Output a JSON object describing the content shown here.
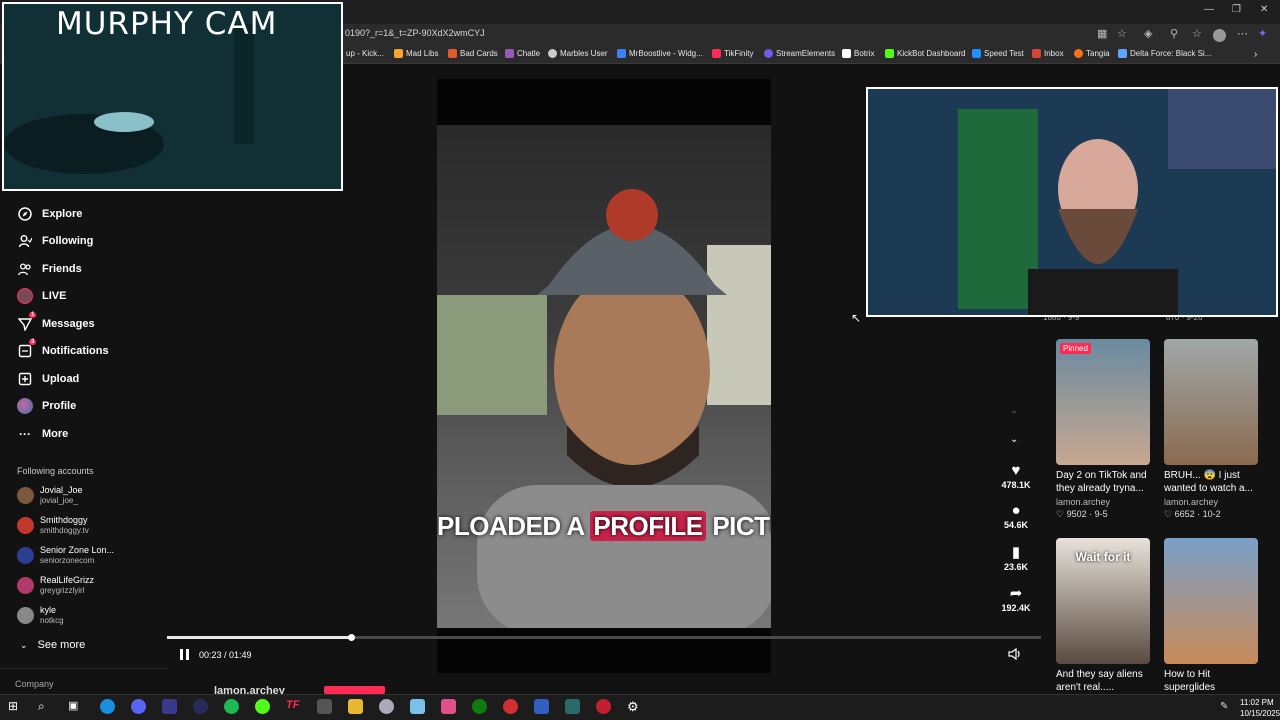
{
  "browser": {
    "url": "0190?_r=1&_t=ZP-90XdX2wmCYJ",
    "bookmarks": [
      {
        "label": "up - Kick...",
        "color": "#53fc18"
      },
      {
        "label": "Mad Libs",
        "color": "#f7a52b"
      },
      {
        "label": "Bad Cards",
        "color": "#e05a2b"
      },
      {
        "label": "Chatle",
        "color": "#9b59b6"
      },
      {
        "label": "Marbles User",
        "color": "#cccccc"
      },
      {
        "label": "MrBoostlive - Widg...",
        "color": "#3b82f6"
      },
      {
        "label": "TikFinity",
        "color": "#fe2c55"
      },
      {
        "label": "StreamElements",
        "color": "#6c5ce7"
      },
      {
        "label": "Botrix",
        "color": "#ffffff"
      },
      {
        "label": "KickBot Dashboard",
        "color": "#53fc18"
      },
      {
        "label": "Speed Test",
        "color": "#1e90ff"
      },
      {
        "label": "Inbox",
        "color": "#d44638"
      },
      {
        "label": "Tangia",
        "color": "#f97316"
      },
      {
        "label": "Delta Force: Black Si...",
        "color": "#60a5fa"
      }
    ]
  },
  "sidebar": {
    "items": [
      {
        "label": "Explore",
        "icon": "compass-icon"
      },
      {
        "label": "Following",
        "icon": "person-icon"
      },
      {
        "label": "Friends",
        "icon": "people-icon"
      },
      {
        "label": "LIVE",
        "icon": "live-icon"
      },
      {
        "label": "Messages",
        "icon": "send-icon",
        "badge": "1"
      },
      {
        "label": "Notifications",
        "icon": "inbox-icon",
        "badge": "3"
      },
      {
        "label": "Upload",
        "icon": "plus-square-icon"
      },
      {
        "label": "Profile",
        "icon": "avatar-icon"
      },
      {
        "label": "More",
        "icon": "more-icon"
      }
    ],
    "following_title": "Following accounts",
    "accounts": [
      {
        "name": "Jovial_Joe",
        "handle": "jovial_joe_",
        "color": "#7a5a3a"
      },
      {
        "name": "Smithdoggy",
        "handle": "smithdoggy.tv",
        "color": "#c0392b"
      },
      {
        "name": "Senior Zone Lon...",
        "handle": "seniorzonecom",
        "color": "#2c3e8f"
      },
      {
        "name": "RealLifeGrizz",
        "handle": "greygrizzlyirl",
        "color": "#b03a6a"
      },
      {
        "name": "kyle",
        "handle": "notkcg",
        "color": "#888888"
      }
    ],
    "see_more": "See more",
    "company": "Company"
  },
  "video": {
    "caption_before": "PLOADED A ",
    "caption_highlight": "PROFILE",
    "caption_after": " PICTUR",
    "time": "00:23 / 01:49",
    "progress": 0.21,
    "author": "lamon.archey"
  },
  "actions": {
    "likes": "478.1K",
    "comments": "54.6K",
    "saves": "23.6K",
    "shares": "192.4K"
  },
  "grid": {
    "partial_stats": [
      "1886 · 9-9",
      "870 · 9-26"
    ],
    "cards": [
      {
        "caption": "Day 2 on TikTok and they already tryna...",
        "user": "lamon.archey",
        "stat": "♡ 9502 · 9-5",
        "pinned": "Pinned",
        "overlay": ""
      },
      {
        "caption": "BRUH... 😨 I just wanted to watch a...",
        "user": "lamon.archey",
        "stat": "♡ 6652 · 10-2",
        "pinned": "",
        "overlay": ""
      },
      {
        "caption": "And they say aliens aren't real.....",
        "user": "",
        "stat": "",
        "pinned": "",
        "overlay": "Wait for it"
      },
      {
        "caption": "How to Hit superglides EASIER...",
        "user": "",
        "stat": "",
        "pinned": "",
        "overlay": ""
      }
    ]
  },
  "cams": {
    "murphy_title": "MURPHY CAM"
  },
  "taskbar": {
    "time": "11:02 PM",
    "date": "10/15/2025"
  }
}
